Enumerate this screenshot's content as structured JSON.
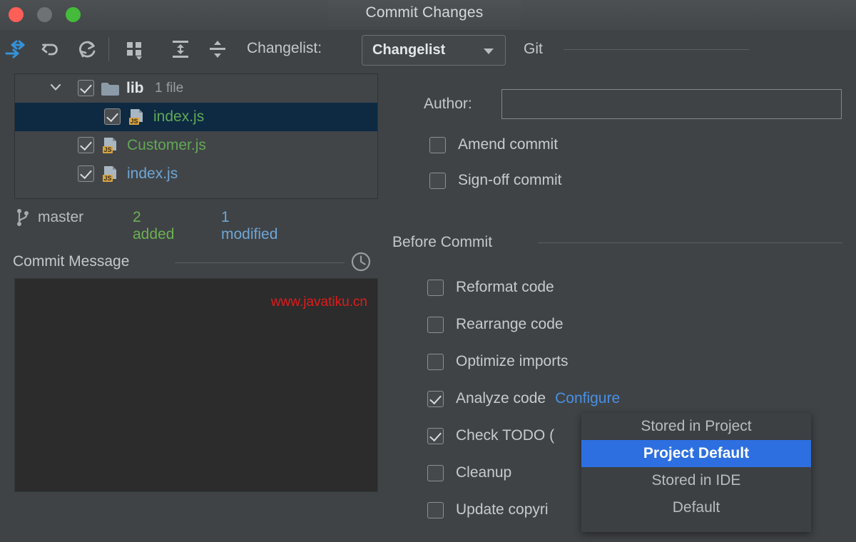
{
  "window": {
    "title": "Commit Changes",
    "controls": [
      {
        "name": "close",
        "color": "#ff5f57"
      },
      {
        "name": "minimize",
        "color": "#6e7274"
      },
      {
        "name": "maximize",
        "color": "#44bb3b"
      }
    ]
  },
  "toolbar": {
    "icons": [
      "commit-arrows-icon",
      "revert-icon",
      "refresh-icon",
      "group-by-icon",
      "expand-all-icon",
      "collapse-all-icon"
    ],
    "changelist_label": "Changelist:",
    "changelist_value": "Changelist",
    "git_label": "Git"
  },
  "tree": {
    "rows": [
      {
        "type": "folder",
        "icon": "folder-icon",
        "label": "lib",
        "count": "1 file",
        "checked": true,
        "expanded": true,
        "selected": false
      },
      {
        "type": "file",
        "icon": "js-file-icon",
        "label": "index.js",
        "color": "#62a856",
        "checked": true,
        "selected": true
      },
      {
        "type": "file",
        "icon": "js-file-icon",
        "label": "Customer.js",
        "color": "#62a856",
        "checked": true,
        "selected": false
      },
      {
        "type": "file",
        "icon": "js-file-icon",
        "label": "index.js",
        "color": "#6fa6d6",
        "checked": true,
        "selected": false
      }
    ]
  },
  "status": {
    "branch_icon": "git-branch-icon",
    "branch": "master",
    "added": "2 added",
    "modified": "1 modified"
  },
  "commit_message": {
    "title": "Commit Message",
    "history_icon": "clock-icon",
    "value": "",
    "watermark": "www.javatiku.cn"
  },
  "author": {
    "label": "Author:",
    "value": "",
    "placeholder": ""
  },
  "commit_options": [
    {
      "label": "Amend commit",
      "checked": false
    },
    {
      "label": "Sign-off commit",
      "checked": false
    }
  ],
  "before_commit": {
    "title": "Before Commit",
    "options": [
      {
        "label": "Reformat code",
        "checked": false,
        "link": ""
      },
      {
        "label": "Rearrange code",
        "checked": false,
        "link": ""
      },
      {
        "label": "Optimize imports",
        "checked": false,
        "link": ""
      },
      {
        "label": "Analyze code",
        "checked": true,
        "link": "Configure"
      },
      {
        "label": "Check TODO (",
        "checked": true,
        "link": ""
      },
      {
        "label": "Cleanup",
        "checked": false,
        "link": ""
      },
      {
        "label": "Update copyri",
        "checked": false,
        "link": ""
      }
    ]
  },
  "dropdown": {
    "items": [
      {
        "label": "Stored in Project",
        "selected": false
      },
      {
        "label": "Project Default",
        "selected": true
      },
      {
        "label": "Stored in IDE",
        "selected": false
      },
      {
        "label": "Default",
        "selected": false
      }
    ],
    "highlight_color": "#2d6fe0"
  }
}
